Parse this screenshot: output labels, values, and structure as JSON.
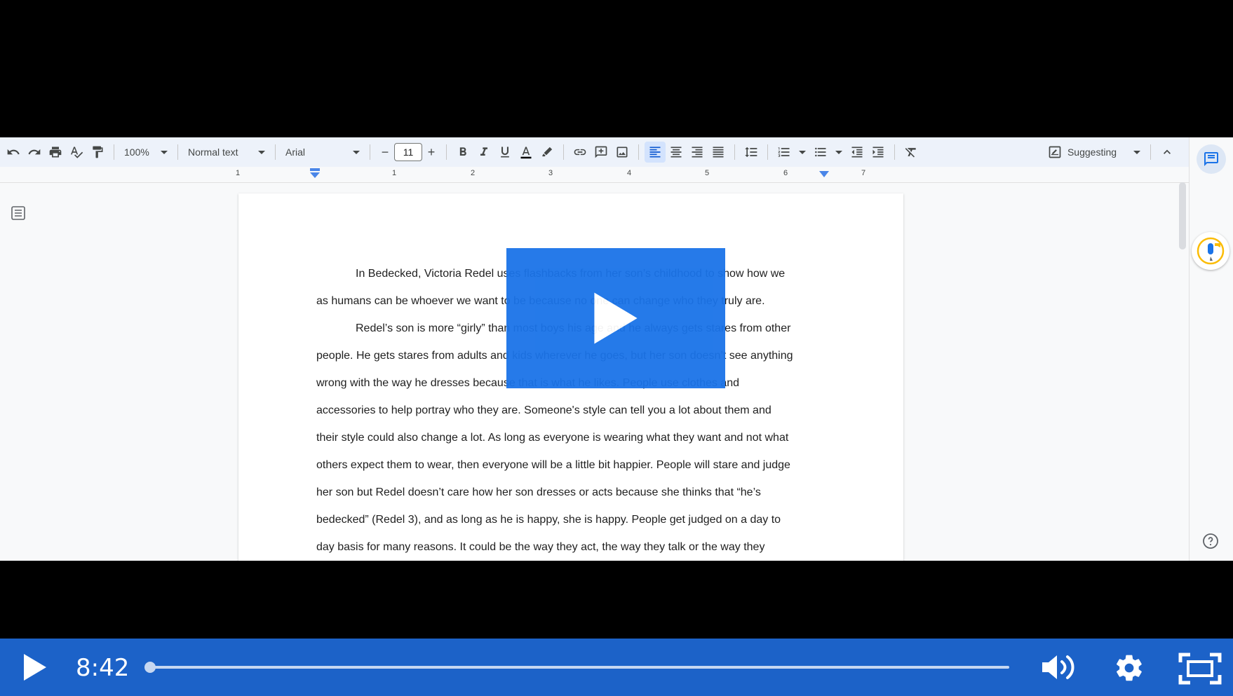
{
  "toolbar": {
    "zoom": "100%",
    "style": "Normal text",
    "font": "Arial",
    "font_size": "11",
    "mode": "Suggesting",
    "colors": {
      "accent": "#1a73e8",
      "toolbar_bg": "#edf2fa"
    }
  },
  "ruler": {
    "marks": [
      "1",
      "1",
      "2",
      "3",
      "4",
      "5",
      "6",
      "7"
    ]
  },
  "document": {
    "lines": [
      "In Bedecked, Victoria Redel uses flashbacks from her son’s childhood to show how we",
      "as humans can be whoever we want to be because no one can change who they truly are.",
      "Redel’s son is more “girly” than most boys his age and he always gets stares from other",
      "people. He gets stares from adults and kids wherever he goes, but her son doesn’t see anything",
      "wrong with the way he dresses because that is what he likes. People use clothes and",
      "accessories to help portray who they are. Someone's style can tell you a lot about them and",
      "their style could also change a lot. As long as everyone is wearing what they want and not what",
      "others expect them to wear, then everyone will be a little bit happier. People will stare and judge",
      "her son but Redel doesn’t care how her son dresses or acts because she thinks that “he’s",
      "bedecked” (Redel 3), and as long as he is happy, she is happy. People get judged on a day to",
      "day basis for many reasons. It could be the way they act, the way they talk or the way they"
    ]
  },
  "player": {
    "time": "8:42",
    "progress": 0.0
  }
}
